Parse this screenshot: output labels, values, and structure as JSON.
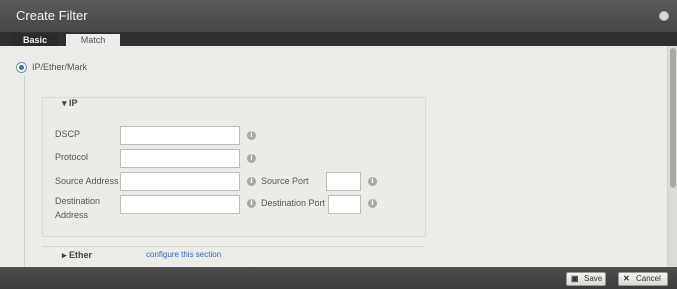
{
  "dialog": {
    "title": "Create Filter"
  },
  "tabs": [
    {
      "label": "Basic",
      "active": true
    },
    {
      "label": "Match",
      "active": false
    }
  ],
  "filter_type": {
    "label": "IP/Ether/Mark",
    "selected": true
  },
  "ip_section": {
    "title": "▾ IP",
    "fields": {
      "dscp": {
        "label": "DSCP",
        "value": ""
      },
      "protocol": {
        "label": "Protocol",
        "value": ""
      },
      "source_address": {
        "label": "Source Address",
        "value": ""
      },
      "source_port": {
        "label": "Source Port",
        "value": ""
      },
      "destination_address": {
        "label_line1": "Destination",
        "label_line2": "Address",
        "value": ""
      },
      "destination_port": {
        "label": "Destination Port",
        "value": ""
      }
    }
  },
  "ether_section": {
    "title": "▸ Ether",
    "link": "configure this section"
  },
  "footer": {
    "save_label": "Save",
    "cancel_label": "Cancel"
  },
  "icons": {
    "info": "info-icon",
    "save": "save-icon",
    "cancel": "close-x-icon"
  },
  "colors": {
    "accent": "#3a66b4",
    "titlebar": "#4f4f4f"
  }
}
